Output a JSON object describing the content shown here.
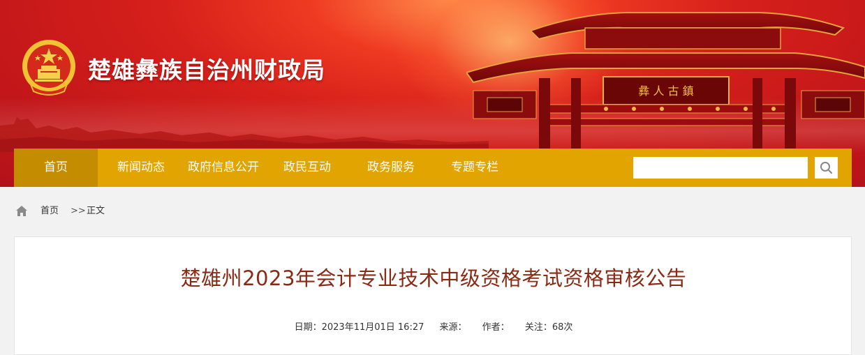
{
  "header": {
    "site_title": "楚雄彝族自治州财政局"
  },
  "nav": {
    "items": [
      {
        "label": "首页",
        "active": true
      },
      {
        "label": "新闻动态"
      },
      {
        "label": "政府信息公开"
      },
      {
        "label": "政民互动"
      },
      {
        "label": "政务服务"
      },
      {
        "label": "专题专栏"
      }
    ],
    "search_placeholder": ""
  },
  "breadcrumb": {
    "home": "首页",
    "separator": ">>",
    "current": "正文"
  },
  "article": {
    "title": "楚雄州2023年会计专业技术中级资格考试资格审核公告",
    "date": "日期：2023年11月01日 16:27",
    "source": "来源：",
    "author": "作者：",
    "views": "关注：68次"
  },
  "colors": {
    "banner_red": "#c3171a",
    "nav_gold": "#e2a400",
    "nav_active": "#c48c00",
    "title_brown": "#8a2a14"
  },
  "icons": [
    "national-emblem",
    "home-icon",
    "search-icon"
  ]
}
